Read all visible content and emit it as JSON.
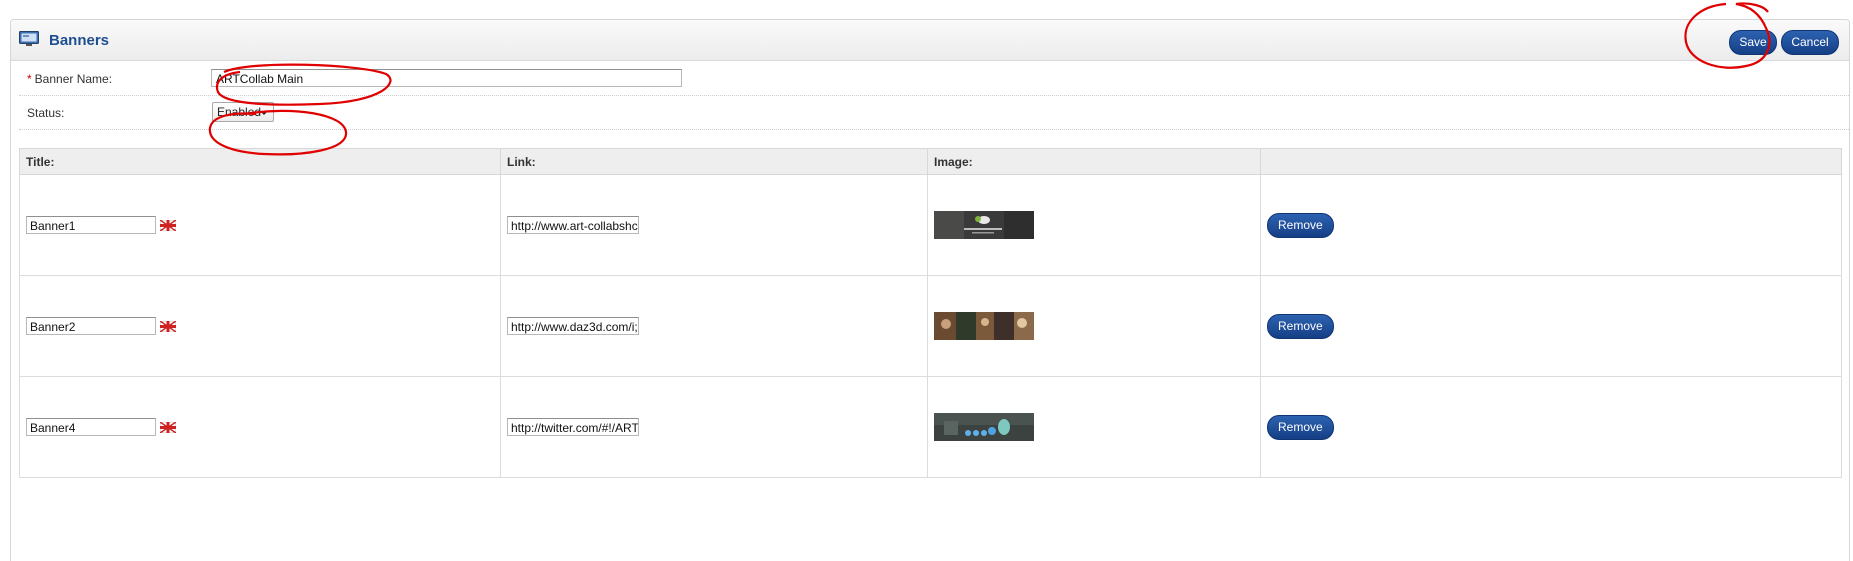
{
  "header": {
    "title": "Banners",
    "icon": "banner-monitor-icon",
    "save_label": "Save",
    "cancel_label": "Cancel"
  },
  "form": {
    "required_marker": "*",
    "banner_name_label": "Banner Name:",
    "banner_name_value": "ARTCollab Main",
    "status_label": "Status:",
    "status_value": "Enabled"
  },
  "table": {
    "headers": [
      "Title:",
      "Link:",
      "Image:",
      ""
    ],
    "rows": [
      {
        "title": "Banner1",
        "link": "http://www.art-collabshc",
        "remove_label": "Remove"
      },
      {
        "title": "Banner2",
        "link": "http://www.daz3d.com/i;",
        "remove_label": "Remove"
      },
      {
        "title": "Banner4",
        "link": "http://twitter.com/#!/ART",
        "remove_label": "Remove"
      }
    ]
  },
  "colors": {
    "accent": "#1d4f91",
    "button": "#1f4f9c",
    "annotation": "#e00000"
  }
}
